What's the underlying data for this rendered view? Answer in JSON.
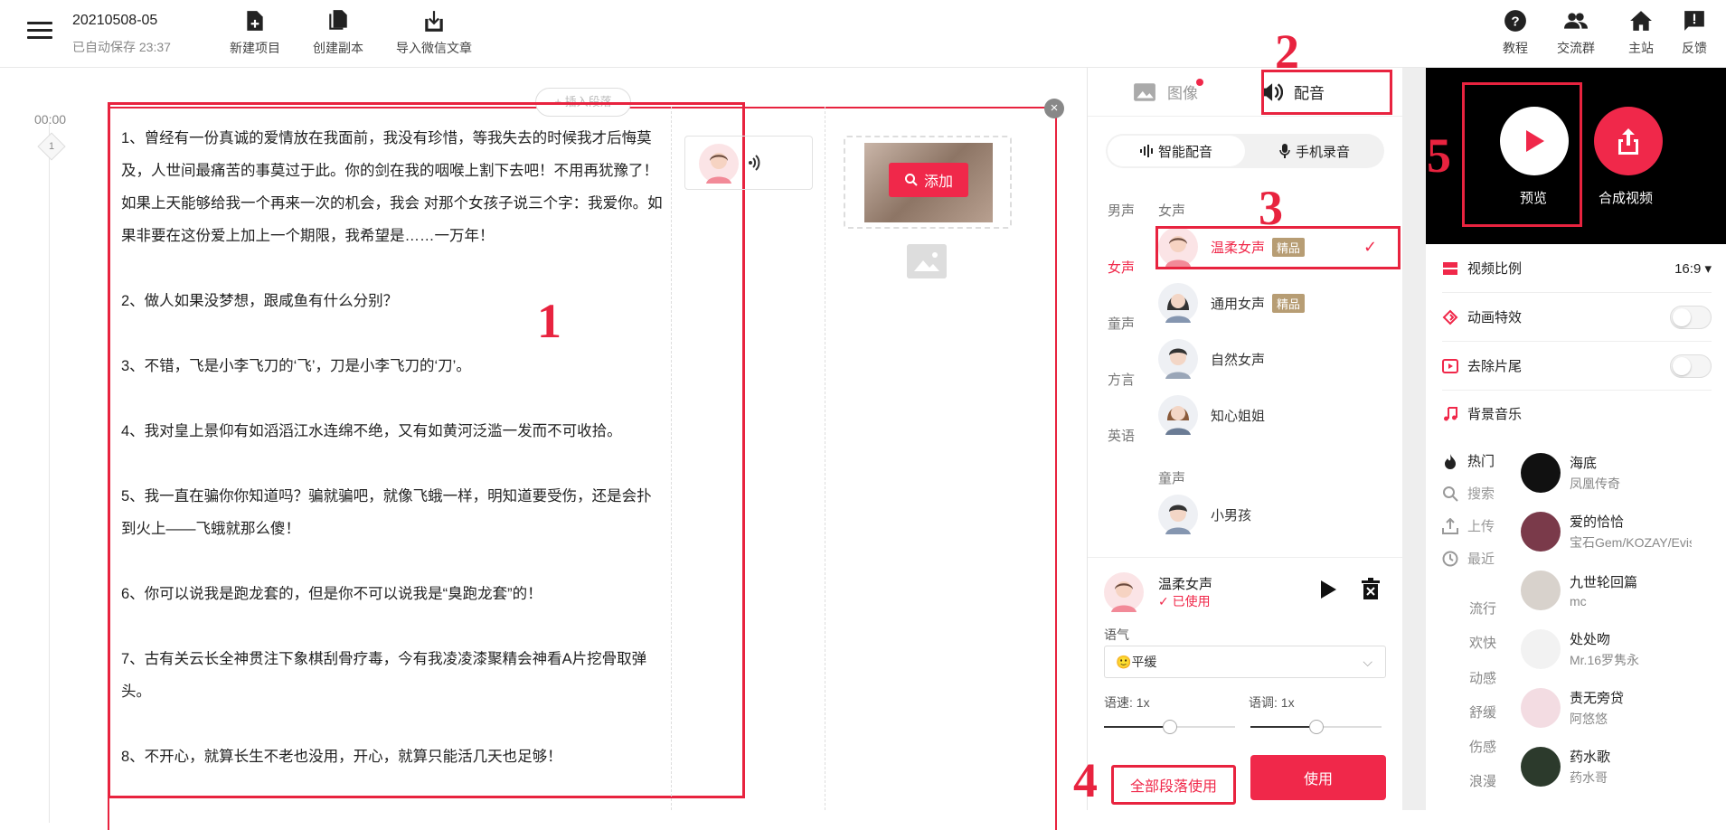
{
  "header": {
    "project_title": "20210508-05",
    "save_status": "已自动保存  23:37",
    "actions": [
      "新建项目",
      "创建副本",
      "导入微信文章"
    ],
    "right_actions": [
      "教程",
      "交流群",
      "主站",
      "反馈"
    ]
  },
  "editor": {
    "time": "00:00",
    "segment_no": "1",
    "insert_label": "+ 插入段落",
    "paragraphs": [
      "1、曾经有一份真诚的爱情放在我面前，我没有珍惜，等我失去的时候我才后悔莫及，人世间最痛苦的事莫过于此。你的剑在我的咽喉上割下去吧！不用再犹豫了！如果上天能够给我一个再来一次的机会，我会  对那个女孩子说三个字：我爱你。如果非要在这份爱上加上一个期限，我希望是……一万年！",
      "2、做人如果没梦想，跟咸鱼有什么分别？",
      "3、不错，飞是小李飞刀的‘飞’，刀是小李飞刀的‘刀’。",
      "4、我对皇上景仰有如滔滔江水连绵不绝，又有如黄河泛滥一发而不可收拾。",
      "5、我一直在骗你你知道吗？骗就骗吧，就像飞蛾一样，明知道要受伤，还是会扑到火上——飞蛾就那么傻！",
      "6、你可以说我是跑龙套的，但是你不可以说我是“臭跑龙套”的！",
      "7、古有关云长全神贯注下象棋刮骨疗毒，今有我凌凌漆聚精会神看A片挖骨取弹头。",
      "8、不开心，就算长生不老也没用，开心，就算只能活几天也足够！"
    ],
    "add_media_label": "添加"
  },
  "voice_panel": {
    "tabs": [
      "图像",
      "配音"
    ],
    "modes": [
      "智能配音",
      "手机录音"
    ],
    "categories": [
      "男声",
      "女声",
      "童声",
      "方言",
      "英语"
    ],
    "group_female": "女声",
    "group_child": "童声",
    "voices": [
      {
        "name": "温柔女声",
        "badge": "精品"
      },
      {
        "name": "通用女声",
        "badge": "精品"
      },
      {
        "name": "自然女声",
        "badge": ""
      },
      {
        "name": "知心姐姐",
        "badge": ""
      },
      {
        "name": "小男孩",
        "badge": ""
      }
    ],
    "current": {
      "name": "温柔女声",
      "status": "已使用"
    },
    "tone_label": "语气",
    "tone_value": "平缓",
    "tone_emoji": "🙂",
    "speed_label": "语速:  1x",
    "pitch_label": "语调:  1x",
    "speed_level": 0.5,
    "pitch_level": 0.5,
    "apply_all_label": "全部段落使用",
    "apply_label": "使用"
  },
  "annotations": [
    "1",
    "2",
    "3",
    "4",
    "5"
  ],
  "preview_panel": {
    "preview_label": "预览",
    "compose_label": "合成视频",
    "ratio_label": "视频比例",
    "ratio_value": "16:9",
    "animation_label": "动画特效",
    "remove_tail_label": "去除片尾",
    "music_label": "背景音乐",
    "music_cats": [
      "热门",
      "搜索",
      "上传",
      "最近"
    ],
    "music_subcats": [
      "流行",
      "欢快",
      "动感",
      "舒缓",
      "伤感",
      "浪漫"
    ],
    "songs": [
      {
        "title": "海底",
        "artist": "凤凰传奇"
      },
      {
        "title": "爱的恰恰",
        "artist": "宝石Gem/KOZAY/Evis..."
      },
      {
        "title": "九世轮回篇",
        "artist": "mc"
      },
      {
        "title": "处处吻",
        "artist": "Mr.16罗隽永"
      },
      {
        "title": "责无旁贷",
        "artist": "阿悠悠"
      },
      {
        "title": "药水歌",
        "artist": "药水哥"
      }
    ]
  },
  "colors": {
    "accent": "#f0284a",
    "annotation": "#e8233f",
    "badge": "#b79d74"
  }
}
